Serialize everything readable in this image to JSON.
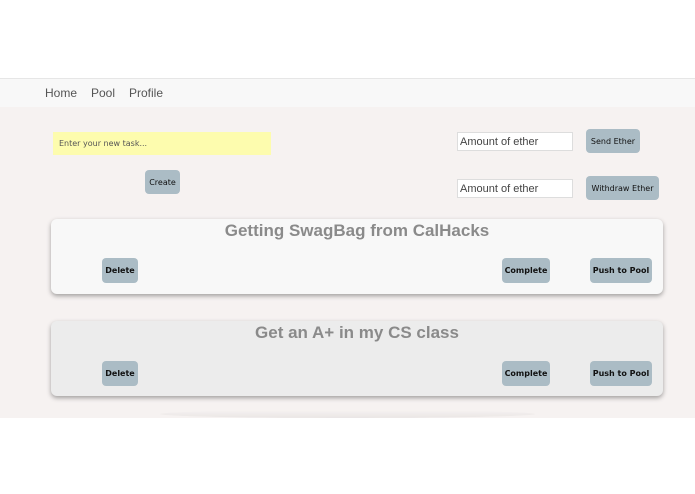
{
  "nav": {
    "items": [
      {
        "label": "Home"
      },
      {
        "label": "Pool"
      },
      {
        "label": "Profile"
      }
    ]
  },
  "task_form": {
    "placeholder": "Enter your new task...",
    "create_label": "Create"
  },
  "ether": {
    "send_placeholder": "Amount of ether",
    "send_label": "Send Ether",
    "withdraw_placeholder": "Amount of ether",
    "withdraw_label": "Withdraw Ether"
  },
  "tasks": [
    {
      "title": "Getting SwagBag from CalHacks",
      "delete_label": "Delete",
      "complete_label": "Complete",
      "push_label": "Push to Pool"
    },
    {
      "title": "Get an A+ in my CS class",
      "delete_label": "Delete",
      "complete_label": "Complete",
      "push_label": "Push to Pool"
    }
  ],
  "colors": {
    "navbar_bg": "#f8f8f8",
    "app_bg": "#f6f2f1",
    "task_input_bg": "#fdfcae",
    "button_bg": "#abbcc5",
    "card1_bg": "#f8f8f8",
    "card2_bg": "#ececec",
    "card_title": "#8a8a8a"
  }
}
